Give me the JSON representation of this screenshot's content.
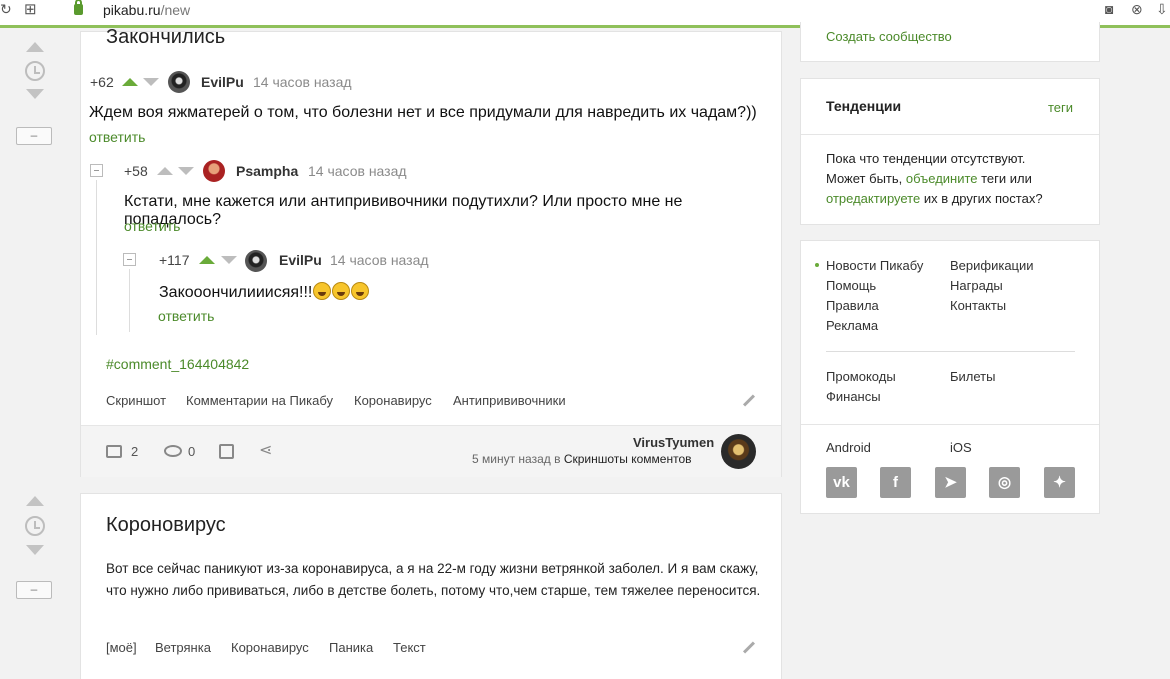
{
  "browser": {
    "url_host": "pikabu.ru",
    "url_path": "/new"
  },
  "post1": {
    "title": "Закончились",
    "comment1": {
      "rating": "+62",
      "nick": "EvilPu",
      "time": "14 часов назад",
      "text": "Ждем воя яжматерей о том, что болезни нет и все придумали для навредить их чадам?))",
      "reply": "ответить"
    },
    "comment2": {
      "rating": "+58",
      "nick": "Psampha",
      "time": "14 часов назад",
      "text": "Кстати, мне кажется или антипрививочники подутихли? Или просто мне не попадалось?",
      "reply": "ответить"
    },
    "comment3": {
      "rating": "+117",
      "nick": "EvilPu",
      "time": "14 часов назад",
      "text": "Закооончилииисяя!!!",
      "reply": "ответить"
    },
    "anchor": "#comment_164404842",
    "tags": [
      "Скриншот",
      "Комментарии на Пикабу",
      "Коронавирус",
      "Антипрививочники"
    ],
    "comments_count": "2",
    "views_count": "0",
    "author": "VirusTyumen",
    "posted": "5 минут назад в",
    "community": "Скриншоты комментов"
  },
  "post2": {
    "title": "Короновирус",
    "text": "Вот все сейчас паникуют из-за коронавируса, а я на 22-м году жизни ветрянкой заболел. И я вам скажу, что нужно либо прививаться, либо в детстве болеть, потому что,чем старше, тем тяжелее переносится.",
    "tags": [
      "[моё]",
      "Ветрянка",
      "Коронавирус",
      "Паника",
      "Текст"
    ]
  },
  "sidebar": {
    "create_community": "Создать сообщество",
    "trends_title": "Тенденции",
    "trends_link": "теги",
    "trends_text_1": "Пока что тенденции отсутствуют.",
    "trends_text_2a": "Может быть, ",
    "trends_link_combine": "объедините",
    "trends_text_2b": " теги или",
    "trends_link_edit": "отредактируете",
    "trends_text_3": " их в других постах?",
    "links_col1": [
      "Новости Пикабу",
      "Помощь",
      "Правила",
      "Реклама"
    ],
    "links_col2": [
      "Верификации",
      "Награды",
      "Контакты"
    ],
    "links2_col1": [
      "Промокоды",
      "Финансы"
    ],
    "links2_col2": [
      "Билеты"
    ],
    "android": "Android",
    "ios": "iOS",
    "social": [
      "vk-icon",
      "facebook-icon",
      "telegram-icon",
      "instagram-icon",
      "zen-icon"
    ]
  },
  "colors": {
    "accent_green": "#4b8a2a",
    "upvote_green": "#6aab3a"
  }
}
